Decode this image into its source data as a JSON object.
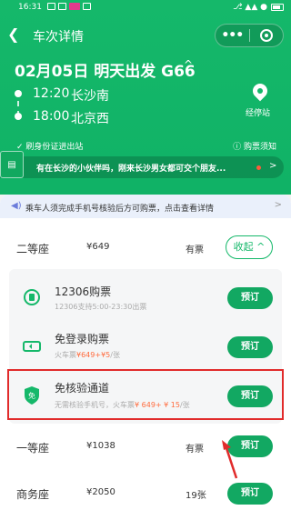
{
  "status_bar": {
    "time": "16:31",
    "right_text": "⎇ ▲▲ ●"
  },
  "nav": {
    "back_label": "❮",
    "title": "车次详情",
    "more_label": "•••"
  },
  "trip": {
    "title": "02月05日 明天出发  G66",
    "chevron": "^",
    "departure_time": "12:20",
    "departure_station": "长沙南",
    "arrival_time": "18:00",
    "arrival_station": "北京西",
    "stops_label": "经停站"
  },
  "notes": {
    "left": "✓ 刷身份证进出站",
    "right": "ⓘ 购票须知"
  },
  "promo": {
    "badge": "▤",
    "text": "有在长沙的小伙伴吗，刚来长沙男女都可交个朋友...",
    "arrow": ">"
  },
  "notice": {
    "icon": "◀)",
    "text": "乘车人须完成手机号核验后方可购票，点击查看详情",
    "arrow": ">"
  },
  "seats": [
    {
      "name": "二等座",
      "price": "¥649",
      "availability": "有票"
    },
    {
      "name": "一等座",
      "price": "¥1038",
      "availability": "有票"
    },
    {
      "name": "商务座",
      "price": "¥2050",
      "availability": "19张"
    }
  ],
  "collapse_label": "收起 ^",
  "options": [
    {
      "title": "12306购票",
      "sub": "12306支持5:00-23:30出票",
      "sub_red": "",
      "sub_tail": "",
      "icon": "train-icon"
    },
    {
      "title": "免登录购票",
      "sub": "火车票",
      "sub_red": "¥649+¥5",
      "sub_tail": "/张",
      "icon": "ticket-icon"
    },
    {
      "title": "免核验通道",
      "sub": "无需核验手机号，火车票",
      "sub_red": "¥ 649+ ¥ 15",
      "sub_tail": "/张",
      "icon": "shield-icon"
    }
  ],
  "book_label": "预订",
  "colors": {
    "brand": "#15b86a",
    "button": "#12a862",
    "highlight": "#e12b2b"
  }
}
